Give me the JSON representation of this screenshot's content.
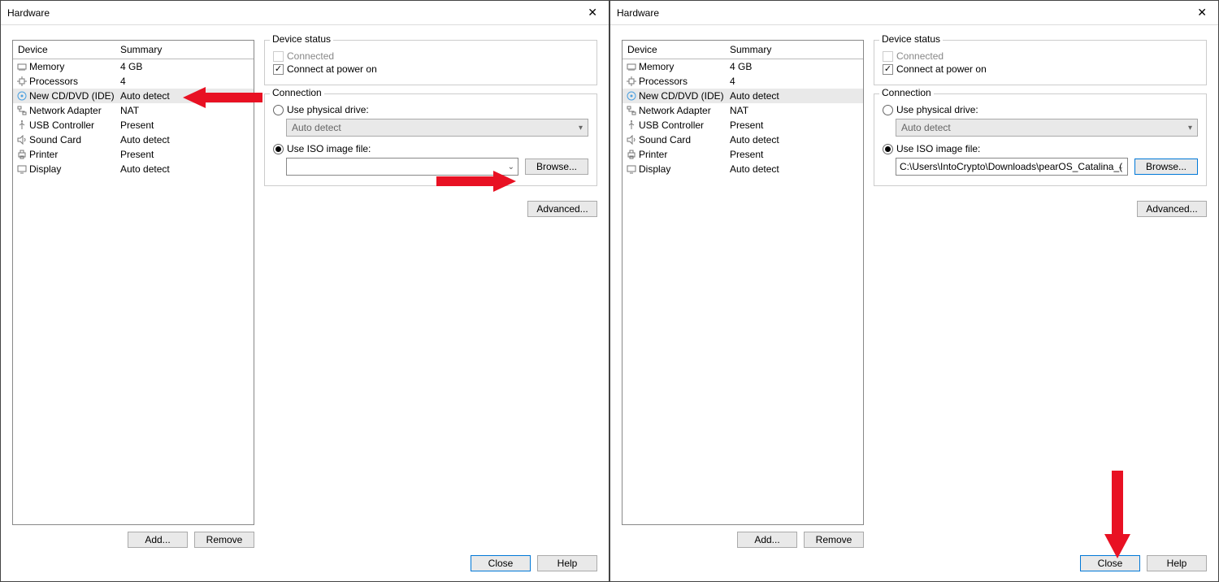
{
  "title": "Hardware",
  "headers": {
    "device": "Device",
    "summary": "Summary"
  },
  "devices": [
    {
      "icon": "memory-icon",
      "name": "Memory",
      "summary": "4 GB",
      "selected": false
    },
    {
      "icon": "cpu-icon",
      "name": "Processors",
      "summary": "4",
      "selected": false
    },
    {
      "icon": "disc-icon",
      "name": "New CD/DVD (IDE)",
      "summary": "Auto detect",
      "selected": true
    },
    {
      "icon": "network-icon",
      "name": "Network Adapter",
      "summary": "NAT",
      "selected": false
    },
    {
      "icon": "usb-icon",
      "name": "USB Controller",
      "summary": "Present",
      "selected": false
    },
    {
      "icon": "sound-icon",
      "name": "Sound Card",
      "summary": "Auto detect",
      "selected": false
    },
    {
      "icon": "printer-icon",
      "name": "Printer",
      "summary": "Present",
      "selected": false
    },
    {
      "icon": "display-icon",
      "name": "Display",
      "summary": "Auto detect",
      "selected": false
    }
  ],
  "buttons": {
    "add": "Add...",
    "remove": "Remove",
    "browse": "Browse...",
    "advanced": "Advanced...",
    "close": "Close",
    "help": "Help"
  },
  "status": {
    "legend": "Device status",
    "connected": "Connected",
    "powerOn": "Connect at power on"
  },
  "connection": {
    "legend": "Connection",
    "physical": "Use physical drive:",
    "physicalValue": "Auto detect",
    "iso": "Use ISO image file:"
  },
  "panelLeft": {
    "isoValue": ""
  },
  "panelRight": {
    "isoValue": "C:\\Users\\IntoCrypto\\Downloads\\pearOS_Catalina_("
  }
}
